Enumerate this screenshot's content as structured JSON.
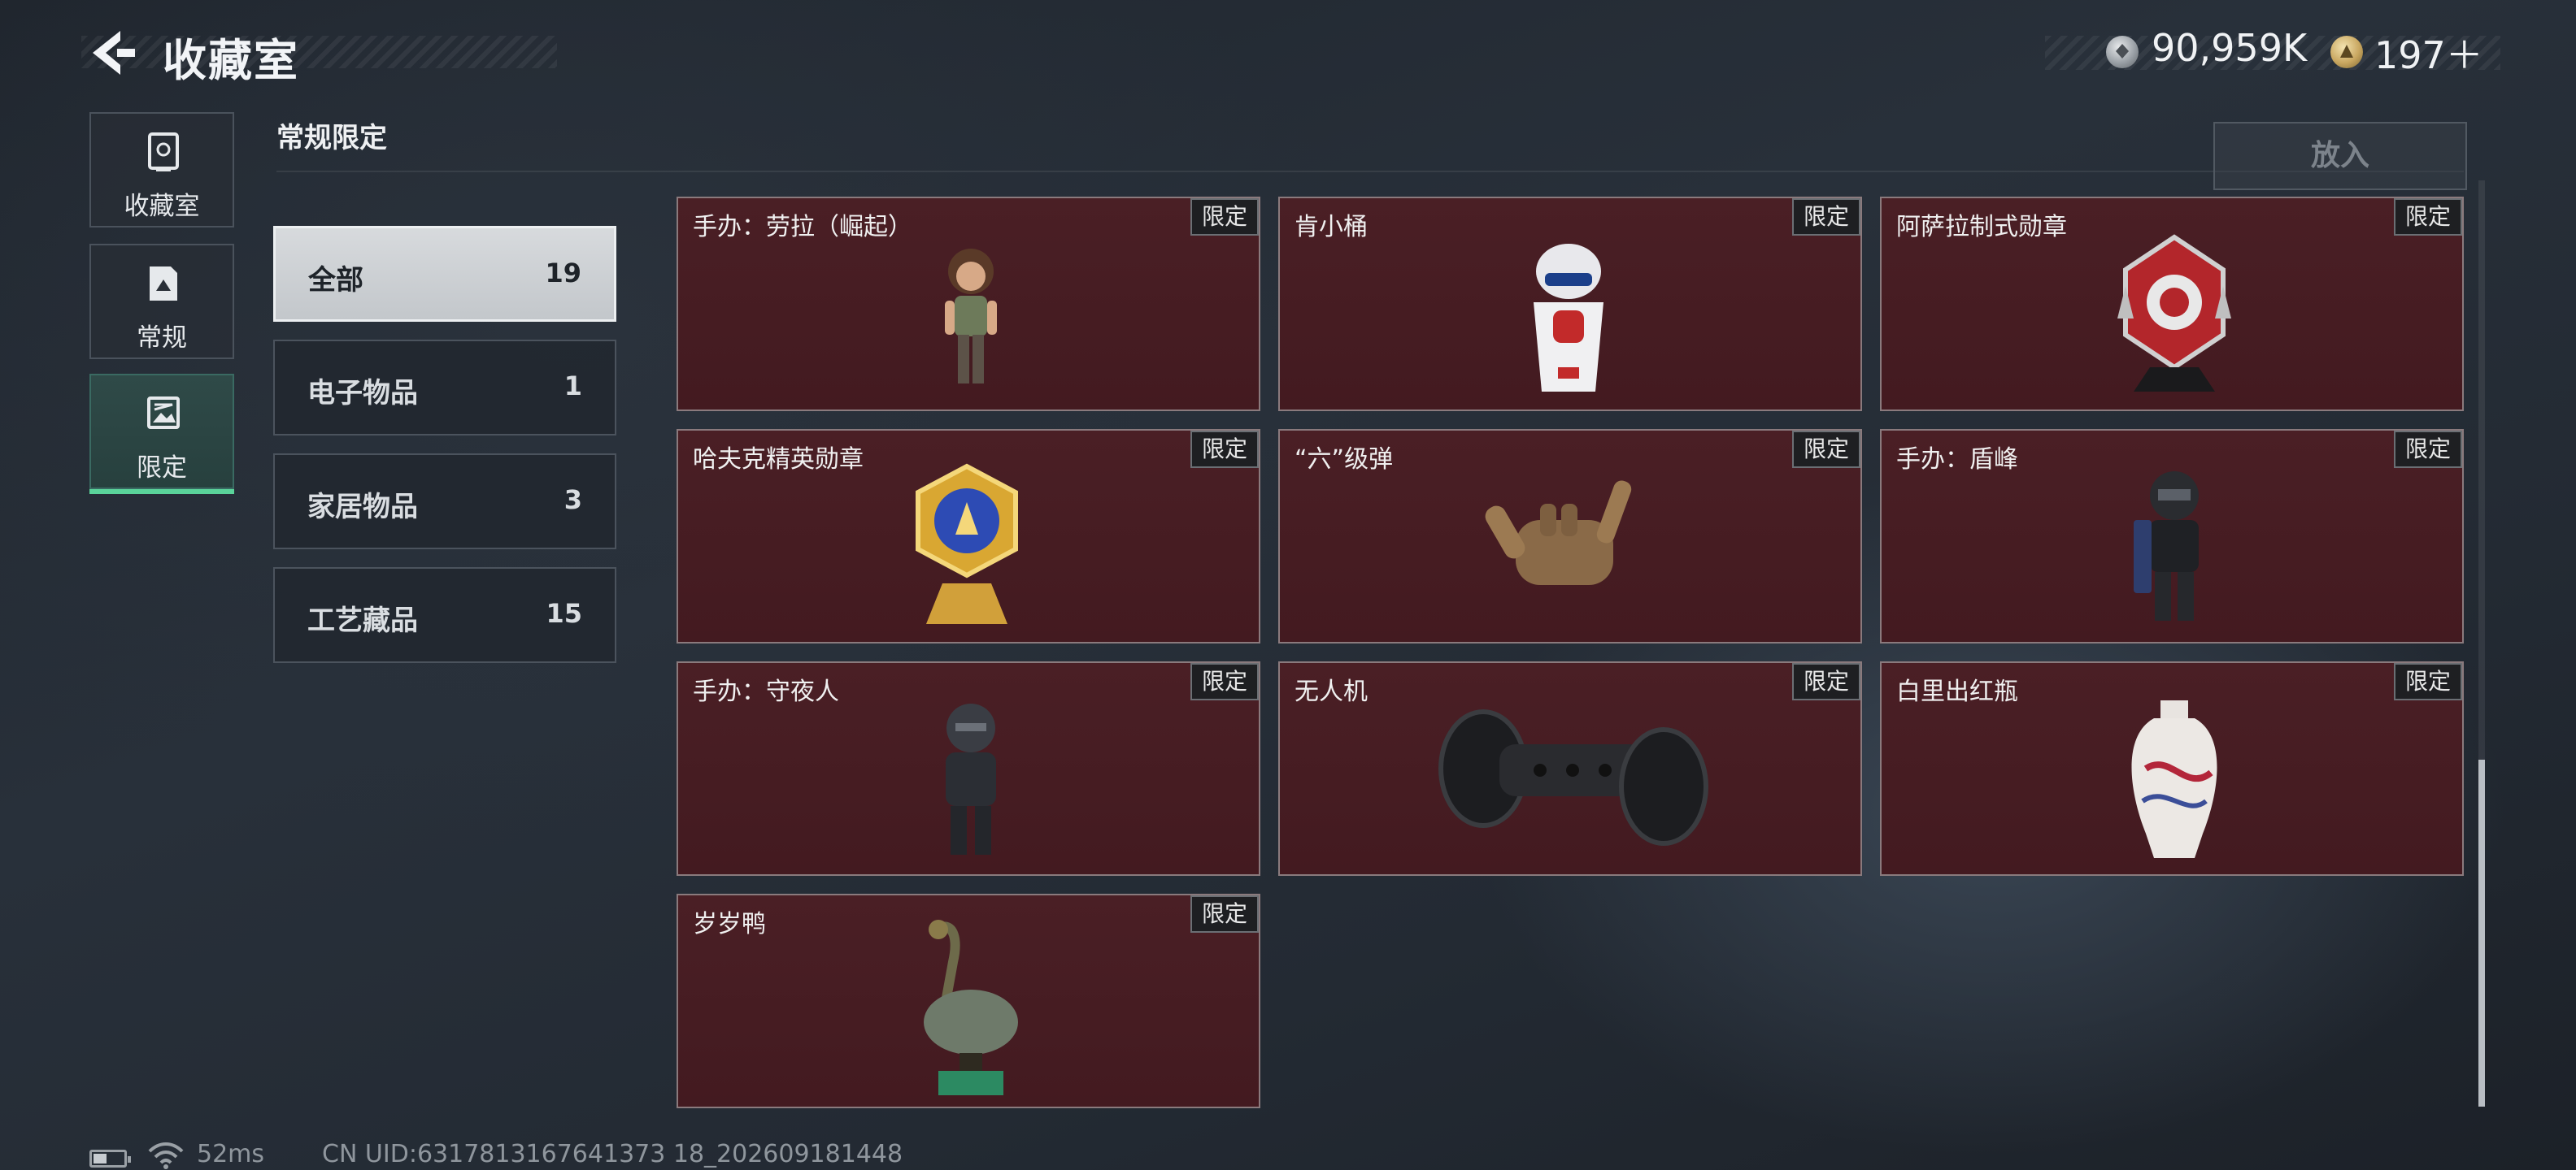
{
  "header": {
    "title": "收藏室",
    "currency_silver": "90,959K",
    "currency_gold": "197＋"
  },
  "nav": [
    {
      "label": "收藏室",
      "icon": "vault-icon"
    },
    {
      "label": "常规",
      "icon": "document-icon"
    },
    {
      "label": "限定",
      "icon": "image-icon",
      "active": true
    }
  ],
  "section_title": "常规限定",
  "insert_button": "放入",
  "categories": [
    {
      "label": "全部",
      "count": "19",
      "active": true
    },
    {
      "label": "电子物品",
      "count": "1"
    },
    {
      "label": "家居物品",
      "count": "3"
    },
    {
      "label": "工艺藏品",
      "count": "15"
    }
  ],
  "badge": "限定",
  "items": [
    {
      "name": "手办：劳拉（崛起）",
      "art": "figure-lara"
    },
    {
      "name": "肯小桶",
      "art": "kfc-bucket"
    },
    {
      "name": "阿萨拉制式勋章",
      "art": "medal-red"
    },
    {
      "name": "哈夫克精英勋章",
      "art": "medal-gold"
    },
    {
      "name": "“六”级弹",
      "art": "bullet-hand"
    },
    {
      "name": "手办：盾峰",
      "art": "figure-shield"
    },
    {
      "name": "手办：守夜人",
      "art": "figure-watchman"
    },
    {
      "name": "无人机",
      "art": "drone"
    },
    {
      "name": "白里出红瓶",
      "art": "vase"
    },
    {
      "name": "岁岁鸭",
      "art": "duck"
    }
  ],
  "status": {
    "ping": "52ms",
    "uid": "CN UID:6317813167641373 18_202609181448"
  },
  "colors": {
    "card_bg": "#4a1f25",
    "active_nav": "#2f4a48",
    "active_accent": "#5ad39a"
  }
}
